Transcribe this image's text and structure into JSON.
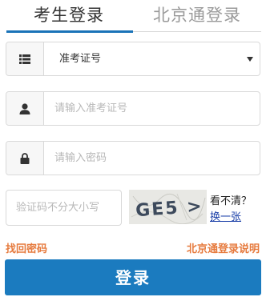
{
  "tabs": {
    "candidate_login": "考生登录",
    "beijing_tong_login": "北京通登录"
  },
  "form": {
    "id_type_selected": "准考证号",
    "id_placeholder": "请输入准考证号",
    "password_placeholder": "请输入密码",
    "captcha_placeholder": "验证码不分大小写",
    "captcha_text": "GE5 >",
    "captcha_hint": "看不清？",
    "captcha_refresh": "换一张"
  },
  "links": {
    "forgot_password": "找回密码",
    "beijing_tong_help": "北京通登录说明"
  },
  "actions": {
    "login": "登录"
  },
  "icons": {
    "id_type": "list-icon",
    "id": "user-icon",
    "password": "lock-icon",
    "dropdown": "caret-down-icon"
  },
  "colors": {
    "primary": "#1b7bbf",
    "tab_underline": "#1a73b8",
    "link": "#e67a3d",
    "refresh_link": "#1a3fa8"
  }
}
